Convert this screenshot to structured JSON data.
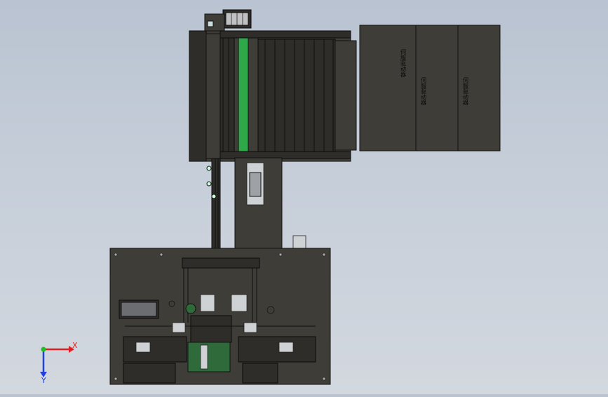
{
  "cabinet_labels": [
    "伺服驱动器",
    "伺服驱动器",
    "伺服驱动器"
  ],
  "triad": {
    "x_label": "X",
    "y_label": "Y",
    "x_color": "#e02020",
    "y_color": "#2040e0",
    "z_color": "#20c020"
  },
  "colors": {
    "background": "#c2cad6",
    "body": "#3e3d38",
    "green_belt": "#2fa84a"
  }
}
